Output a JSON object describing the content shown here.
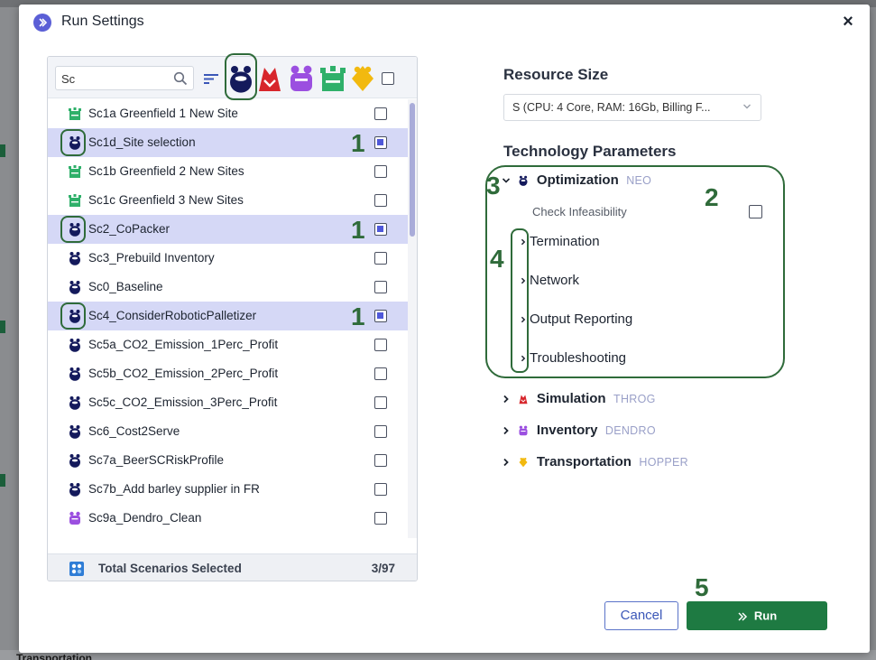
{
  "dialog": {
    "title": "Run Settings",
    "close_label": "×"
  },
  "scenario_panel": {
    "search": {
      "value": "Sc",
      "placeholder": ""
    },
    "filter_icons": [
      "neo-icon",
      "throg-icon",
      "dendro-icon",
      "greenfield-icon",
      "hopper-icon"
    ],
    "rows": [
      {
        "label": "Sc1a Greenfield 1 New Site",
        "icon": "greenfield-icon",
        "selected": false
      },
      {
        "label": "Sc1d_Site selection",
        "icon": "neo-icon",
        "selected": true
      },
      {
        "label": "Sc1b Greenfield 2 New Sites",
        "icon": "greenfield-icon",
        "selected": false
      },
      {
        "label": "Sc1c Greenfield 3 New Sites",
        "icon": "greenfield-icon",
        "selected": false
      },
      {
        "label": "Sc2_CoPacker",
        "icon": "neo-icon",
        "selected": true
      },
      {
        "label": "Sc3_Prebuild Inventory",
        "icon": "neo-icon",
        "selected": false
      },
      {
        "label": "Sc0_Baseline",
        "icon": "neo-icon",
        "selected": false
      },
      {
        "label": "Sc4_ConsiderRoboticPalletizer",
        "icon": "neo-icon",
        "selected": true
      },
      {
        "label": "Sc5a_CO2_Emission_1Perc_Profit",
        "icon": "neo-icon",
        "selected": false
      },
      {
        "label": "Sc5b_CO2_Emission_2Perc_Profit",
        "icon": "neo-icon",
        "selected": false
      },
      {
        "label": "Sc5c_CO2_Emission_3Perc_Profit",
        "icon": "neo-icon",
        "selected": false
      },
      {
        "label": "Sc6_Cost2Serve",
        "icon": "neo-icon",
        "selected": false
      },
      {
        "label": "Sc7a_BeerSCRiskProfile",
        "icon": "neo-icon",
        "selected": false
      },
      {
        "label": "Sc7b_Add barley supplier in FR",
        "icon": "neo-icon",
        "selected": false
      },
      {
        "label": "Sc9a_Dendro_Clean",
        "icon": "dendro-icon",
        "selected": false
      }
    ],
    "footer": {
      "label": "Total Scenarios Selected",
      "count": "3/97"
    }
  },
  "resource": {
    "title": "Resource Size",
    "value": "S (CPU: 4 Core, RAM: 16Gb, Billing F..."
  },
  "technology": {
    "title": "Technology Parameters",
    "engines": [
      {
        "name": "Optimization",
        "sub": "NEO",
        "icon": "neo-icon",
        "expanded": true
      },
      {
        "name": "Simulation",
        "sub": "THROG",
        "icon": "throg-icon",
        "expanded": false
      },
      {
        "name": "Inventory",
        "sub": "DENDRO",
        "icon": "dendro-icon",
        "expanded": false
      },
      {
        "name": "Transportation",
        "sub": "HOPPER",
        "icon": "hopper-icon",
        "expanded": false
      }
    ],
    "check_infeasibility_label": "Check Infeasibility",
    "subsections": [
      "Termination",
      "Network",
      "Output Reporting",
      "Troubleshooting"
    ]
  },
  "buttons": {
    "cancel": "Cancel",
    "run": "Run"
  },
  "annotations": [
    "1",
    "1",
    "1",
    "2",
    "3",
    "4",
    "5"
  ],
  "background": {
    "bottom_text": "Transportation"
  },
  "colors": {
    "selected_row": "#d5d8f6",
    "checkbox_fill": "#4f58d9",
    "run_button": "#1e7a42",
    "annotation": "#2f6b3a",
    "neo": "#141a5c",
    "throg": "#d7262c",
    "dendro": "#9b4fe0",
    "greenfield": "#2fb06a",
    "hopper": "#f2b90f"
  }
}
